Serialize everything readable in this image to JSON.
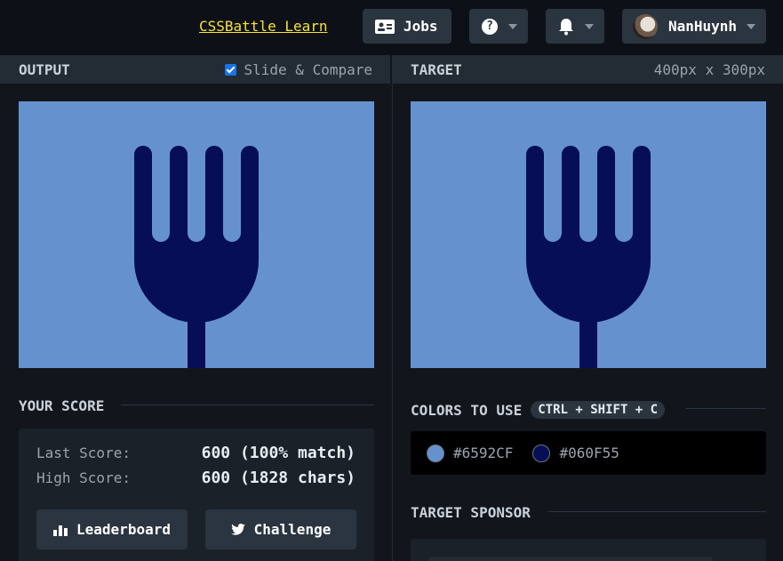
{
  "header": {
    "learn_link": "CSSBattle Learn",
    "jobs_label": "Jobs",
    "username": "NanHuynh"
  },
  "output_panel": {
    "title": "OUTPUT",
    "slide_compare_label": "Slide & Compare",
    "slide_compare_checked": true
  },
  "target_panel": {
    "title": "TARGET",
    "dimensions": "400px x 300px"
  },
  "canvas": {
    "background": "#6592CF",
    "fork_color": "#060F55"
  },
  "score": {
    "title": "YOUR SCORE",
    "last_label": "Last Score:",
    "last_value": "600 (100% match)",
    "high_label": "High Score:",
    "high_value": "600 (1828 chars)",
    "leaderboard_label": "Leaderboard",
    "challenge_label": "Challenge"
  },
  "colors": {
    "title": "COLORS TO USE",
    "shortcut": "CTRL + SHIFT + C",
    "items": [
      {
        "hex": "#6592CF",
        "label": "#6592CF"
      },
      {
        "hex": "#060F55",
        "label": "#060F55"
      }
    ]
  },
  "sponsor": {
    "title": "TARGET SPONSOR"
  }
}
